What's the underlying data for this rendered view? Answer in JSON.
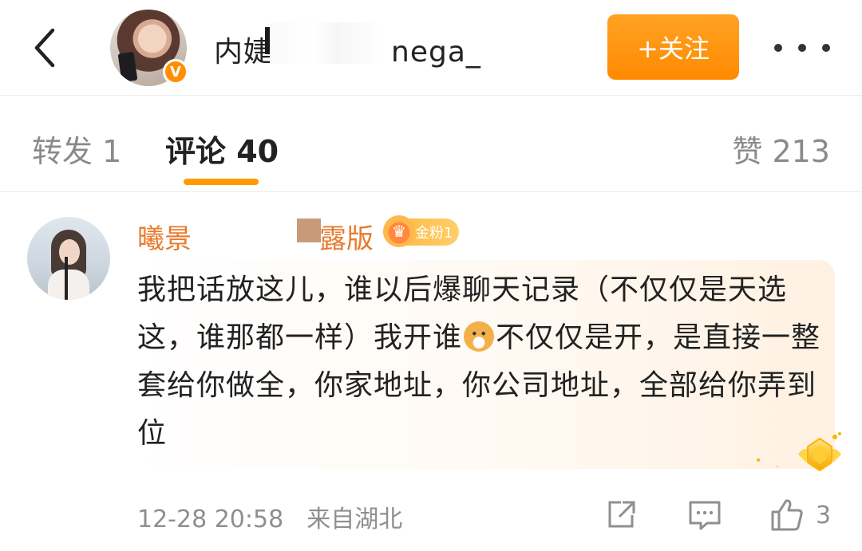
{
  "header": {
    "back_icon": "chevron-left-icon",
    "name_visible_start": "内婕",
    "name_visible_end": "nega_",
    "verified_badge": "V",
    "follow_label": "+关注",
    "more_icon": "more-horizontal-icon",
    "accent_color": "#ff9a00"
  },
  "tabs": {
    "repost": "转发 1",
    "comments": "评论 40",
    "likes": "赞 213"
  },
  "comment": {
    "username_start": "曦景",
    "username_end": "露版",
    "fan_badge": "金粉1",
    "text_1": "我把话放这儿，谁以后爆聊天记录（不仅仅是天选这，谁那都一样）我开谁",
    "emoji": "doge-emoji",
    "text_2": "不仅仅是开，是直接一整套给你做全，你家地址，你公司地址，全部给你弄到位",
    "timestamp": "12-28 20:58",
    "location": "来自湖北",
    "like_count": "3",
    "username_color": "#e97a2c"
  }
}
